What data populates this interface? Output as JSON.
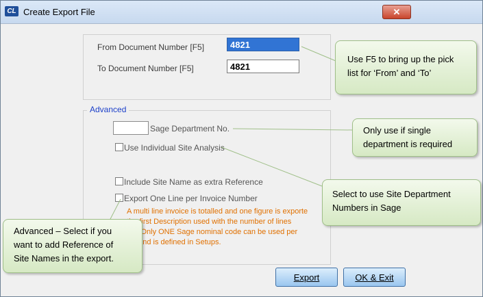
{
  "window": {
    "app_icon_text": "CL",
    "title": "Create Export File",
    "close_glyph": "✕"
  },
  "form": {
    "from_label": "From Document Number [F5]",
    "from_value": "4821",
    "to_label": "To Document Number [F5]",
    "to_value": "4821",
    "advanced_legend": "Advanced",
    "sage_dept_label": "Sage Department No.",
    "sage_dept_value": "",
    "use_site_analysis_label": "Use Individual Site Analysis",
    "include_site_name_label": "Include Site Name as extra Reference",
    "export_one_line_label": "Export One Line per Invoice Number",
    "note_lines": [
      "A multi line invoice is totalled and one figure is exporte",
      "the first Description used with the number of lines",
      "Ln'. Only ONE Sage nominal code can be used per",
      "ice and is defined in Setups."
    ],
    "export_button": "Export",
    "ok_exit_button": "OK & Exit"
  },
  "callouts": {
    "f5": [
      "Use F5 to bring up the pick",
      "list for ‘From’ and ‘To’"
    ],
    "single_dept": [
      "Only use if single",
      "department is required"
    ],
    "site_dept": [
      "Select to use Site Department",
      "Numbers in Sage"
    ],
    "advanced": [
      "Advanced – Select if you",
      "want to add Reference of",
      "Site Names in the export."
    ]
  }
}
